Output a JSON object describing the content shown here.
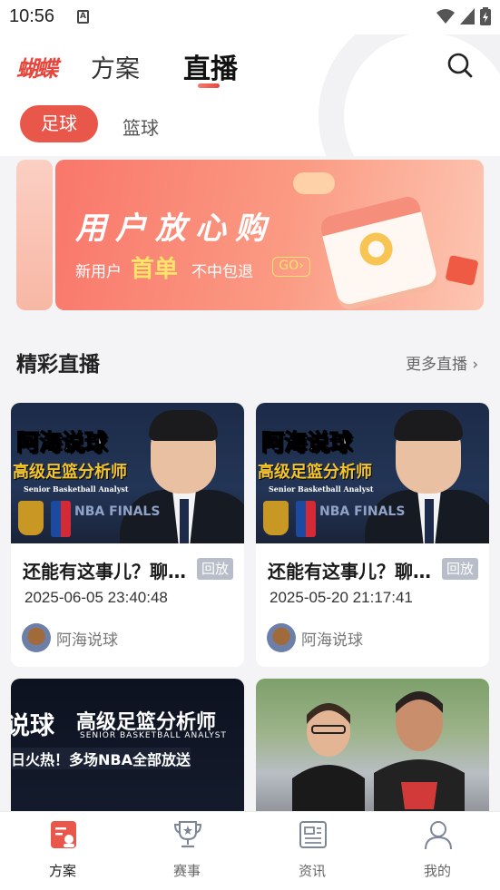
{
  "status_bar": {
    "time": "10:56",
    "notification_glyph": "A"
  },
  "header": {
    "logo": "蝴蝶",
    "tabs": [
      {
        "label": "方案",
        "active": false
      },
      {
        "label": "直播",
        "active": true
      }
    ],
    "filters": [
      {
        "label": "足球",
        "active": true
      },
      {
        "label": "篮球",
        "active": false
      }
    ]
  },
  "banner": {
    "title": "用户放心购",
    "sub_prefix": "新用户",
    "sub_highlight": "首单",
    "sub_suffix": "不中包退",
    "go_label": "GO›"
  },
  "section": {
    "title": "精彩直播",
    "more": "更多直播 ›"
  },
  "cards": [
    {
      "thumb_title": "阿海说球",
      "thumb_subtitle": "高级足篮分析师",
      "thumb_caption": "Senior Basketball Analyst",
      "thumb_finals": "NBA FINALS",
      "title": "还能有这事儿？聊…",
      "tag": "回放",
      "date": "2025-06-05 23:40:48",
      "author": "阿海说球"
    },
    {
      "thumb_title": "阿海说球",
      "thumb_subtitle": "高级足篮分析师",
      "thumb_caption": "Senior Basketball Analyst",
      "thumb_finals": "NBA FINALS",
      "title": "还能有这事儿？聊…",
      "tag": "回放",
      "date": "2025-05-20 21:17:41",
      "author": "阿海说球"
    }
  ],
  "cards_partial": [
    {
      "line1": "说球",
      "line2": "高级足篮分析师",
      "line3": "SENIOR BASKETBALL ANALYST",
      "line4": "日火热！多场NBA全部放送"
    },
    {}
  ],
  "bottom_nav": [
    {
      "label": "方案",
      "icon": "plan-icon",
      "active": true
    },
    {
      "label": "赛事",
      "icon": "trophy-icon",
      "active": false
    },
    {
      "label": "资讯",
      "icon": "news-icon",
      "active": false
    },
    {
      "label": "我的",
      "icon": "user-icon",
      "active": false
    }
  ],
  "colors": {
    "accent": "#e9564a",
    "tag_grey": "#b7bdc9",
    "highlight_yellow": "#ffe46a"
  }
}
